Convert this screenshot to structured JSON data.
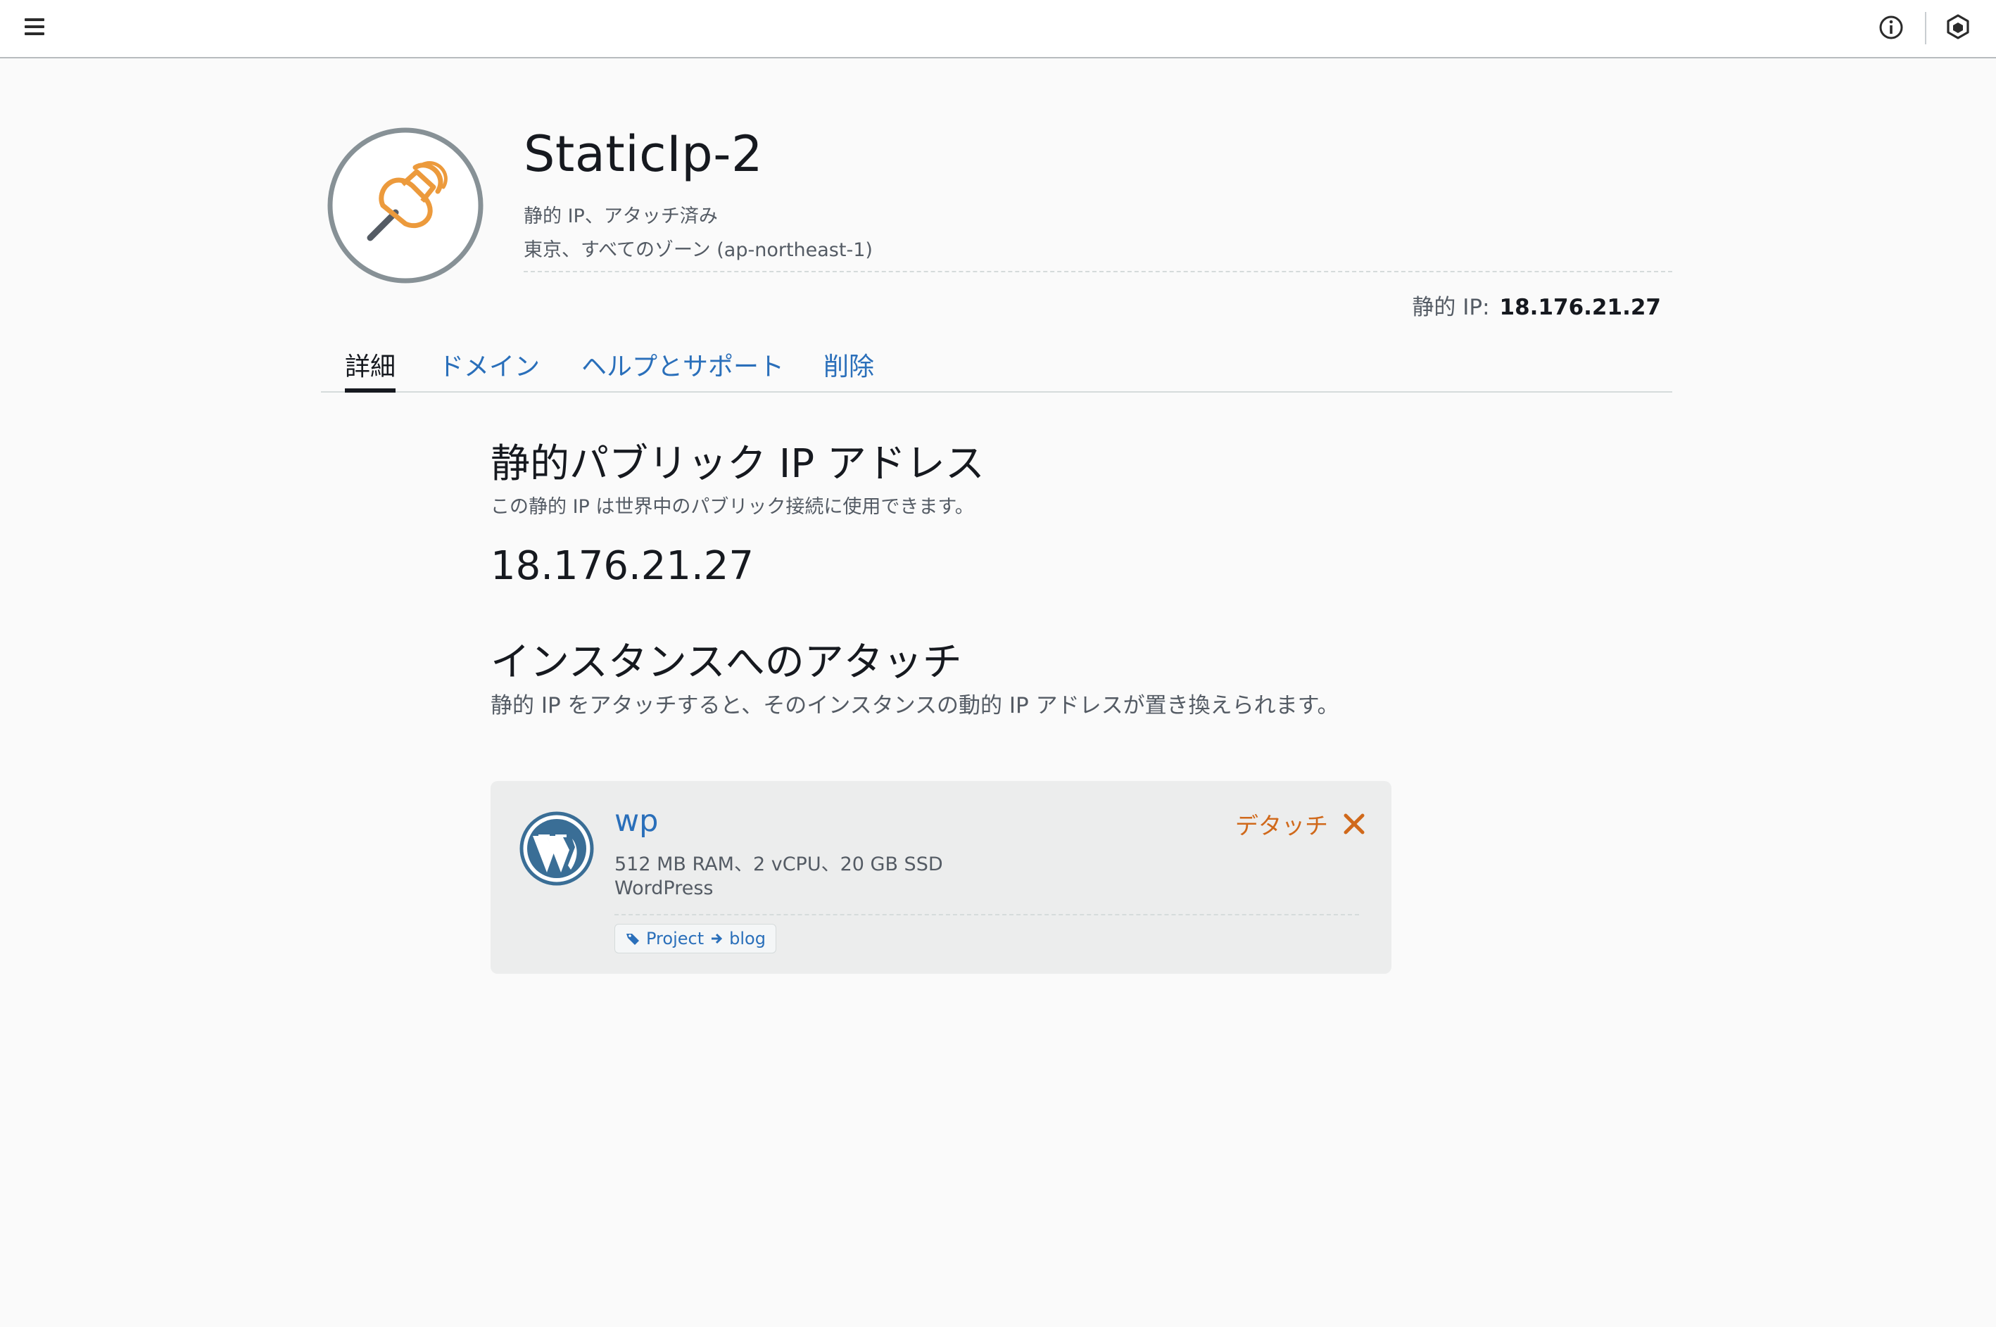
{
  "topbar": {
    "menu_icon": "hamburger-icon",
    "info_icon": "info-icon",
    "settings_icon": "cube-icon"
  },
  "resource": {
    "icon": "pushpin-icon",
    "title": "StaticIp-2",
    "status": "静的 IP、アタッチ済み",
    "location": "東京、すべてのゾーン (ap-northeast-1)",
    "ip_label": "静的 IP:",
    "ip_value": "18.176.21.27",
    "accent_color": "#ec9a3c"
  },
  "tabs": [
    {
      "label": "詳細",
      "active": true
    },
    {
      "label": "ドメイン",
      "active": false
    },
    {
      "label": "ヘルプとサポート",
      "active": false
    },
    {
      "label": "削除",
      "active": false
    }
  ],
  "public_ip_section": {
    "heading": "静的パブリック IP アドレス",
    "description": "この静的 IP は世界中のパブリック接続に使用できます。",
    "ip": "18.176.21.27"
  },
  "attach_section": {
    "heading": "インスタンスへのアタッチ",
    "description": "静的 IP をアタッチすると、そのインスタンスの動的 IP アドレスが置き換えられます。"
  },
  "instance_card": {
    "logo": "wordpress-icon",
    "name": "wp",
    "specs": "512 MB RAM、2 vCPU、20 GB SSD",
    "blueprint": "WordPress",
    "tag_key": "Project",
    "tag_value": "blog",
    "detach_label": "デタッチ",
    "detach_color": "#d0691b"
  }
}
